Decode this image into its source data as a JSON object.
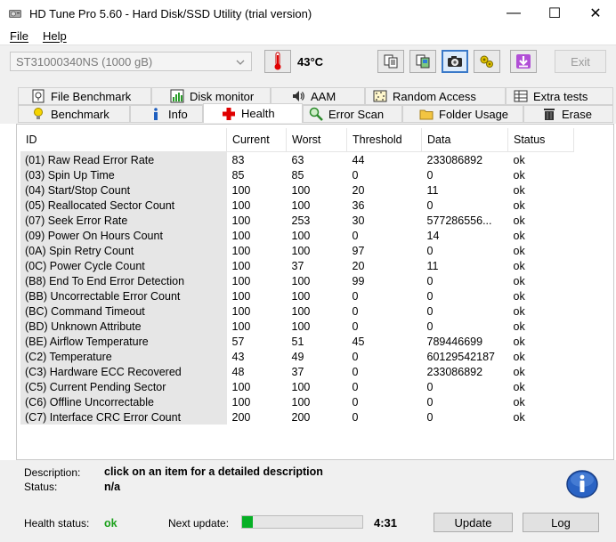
{
  "window": {
    "title": "HD Tune Pro 5.60 - Hard Disk/SSD Utility (trial version)",
    "minimize": "—",
    "maximize": "☐",
    "close": "✕"
  },
  "menu": [
    {
      "label": "File",
      "icon": null
    },
    {
      "label": "Help",
      "icon": null
    }
  ],
  "toolbar": {
    "drive": "ST31000340NS (1000 gB)",
    "temperature": "43°C",
    "exit_label": "Exit",
    "buttons": [
      "copy-text-icon",
      "copy-screenshot-icon",
      "camera-icon",
      "options-icon",
      "save-arrow-icon"
    ],
    "active_button": "camera-icon"
  },
  "tabs": {
    "row1": [
      {
        "label": "File Benchmark",
        "icon": "file-benchmark-icon"
      },
      {
        "label": "Disk monitor",
        "icon": "disk-monitor-icon"
      },
      {
        "label": "AAM",
        "icon": "speaker-icon"
      },
      {
        "label": "Random Access",
        "icon": "random-access-icon"
      },
      {
        "label": "Extra tests",
        "icon": "extra-tests-icon"
      }
    ],
    "row2": [
      {
        "label": "Benchmark",
        "icon": "benchmark-icon"
      },
      {
        "label": "Info",
        "icon": "info-icon"
      },
      {
        "label": "Health",
        "icon": "health-cross-icon"
      },
      {
        "label": "Error Scan",
        "icon": "magnifier-icon"
      },
      {
        "label": "Folder Usage",
        "icon": "folder-icon"
      },
      {
        "label": "Erase",
        "icon": "trash-icon"
      }
    ],
    "active": "Health"
  },
  "table": {
    "columns": [
      "ID",
      "Current",
      "Worst",
      "Threshold",
      "Data",
      "Status"
    ],
    "rows": [
      [
        "(01) Raw Read Error Rate",
        "83",
        "63",
        "44",
        "233086892",
        "ok"
      ],
      [
        "(03) Spin Up Time",
        "85",
        "85",
        "0",
        "0",
        "ok"
      ],
      [
        "(04) Start/Stop Count",
        "100",
        "100",
        "20",
        "11",
        "ok"
      ],
      [
        "(05) Reallocated Sector Count",
        "100",
        "100",
        "36",
        "0",
        "ok"
      ],
      [
        "(07) Seek Error Rate",
        "100",
        "253",
        "30",
        "577286556...",
        "ok"
      ],
      [
        "(09) Power On Hours Count",
        "100",
        "100",
        "0",
        "14",
        "ok"
      ],
      [
        "(0A) Spin Retry Count",
        "100",
        "100",
        "97",
        "0",
        "ok"
      ],
      [
        "(0C) Power Cycle Count",
        "100",
        "37",
        "20",
        "11",
        "ok"
      ],
      [
        "(B8) End To End Error Detection",
        "100",
        "100",
        "99",
        "0",
        "ok"
      ],
      [
        "(BB) Uncorrectable Error Count",
        "100",
        "100",
        "0",
        "0",
        "ok"
      ],
      [
        "(BC) Command Timeout",
        "100",
        "100",
        "0",
        "0",
        "ok"
      ],
      [
        "(BD) Unknown Attribute",
        "100",
        "100",
        "0",
        "0",
        "ok"
      ],
      [
        "(BE) Airflow Temperature",
        "57",
        "51",
        "45",
        "789446699",
        "ok"
      ],
      [
        "(C2) Temperature",
        "43",
        "49",
        "0",
        "60129542187",
        "ok"
      ],
      [
        "(C3) Hardware ECC Recovered",
        "48",
        "37",
        "0",
        "233086892",
        "ok"
      ],
      [
        "(C5) Current Pending Sector",
        "100",
        "100",
        "0",
        "0",
        "ok"
      ],
      [
        "(C6) Offline Uncorrectable",
        "100",
        "100",
        "0",
        "0",
        "ok"
      ],
      [
        "(C7) Interface CRC Error Count",
        "200",
        "200",
        "0",
        "0",
        "ok"
      ]
    ]
  },
  "details": {
    "description_label": "Description:",
    "description_value": "click on an item for a detailed description",
    "status_label": "Status:",
    "status_value": "n/a"
  },
  "footer": {
    "health_label": "Health status:",
    "health_value": "ok",
    "health_color": "#1aa01a",
    "next_update_label": "Next update:",
    "progress_fraction": 0.09,
    "countdown": "4:31",
    "update_label": "Update",
    "log_label": "Log"
  }
}
